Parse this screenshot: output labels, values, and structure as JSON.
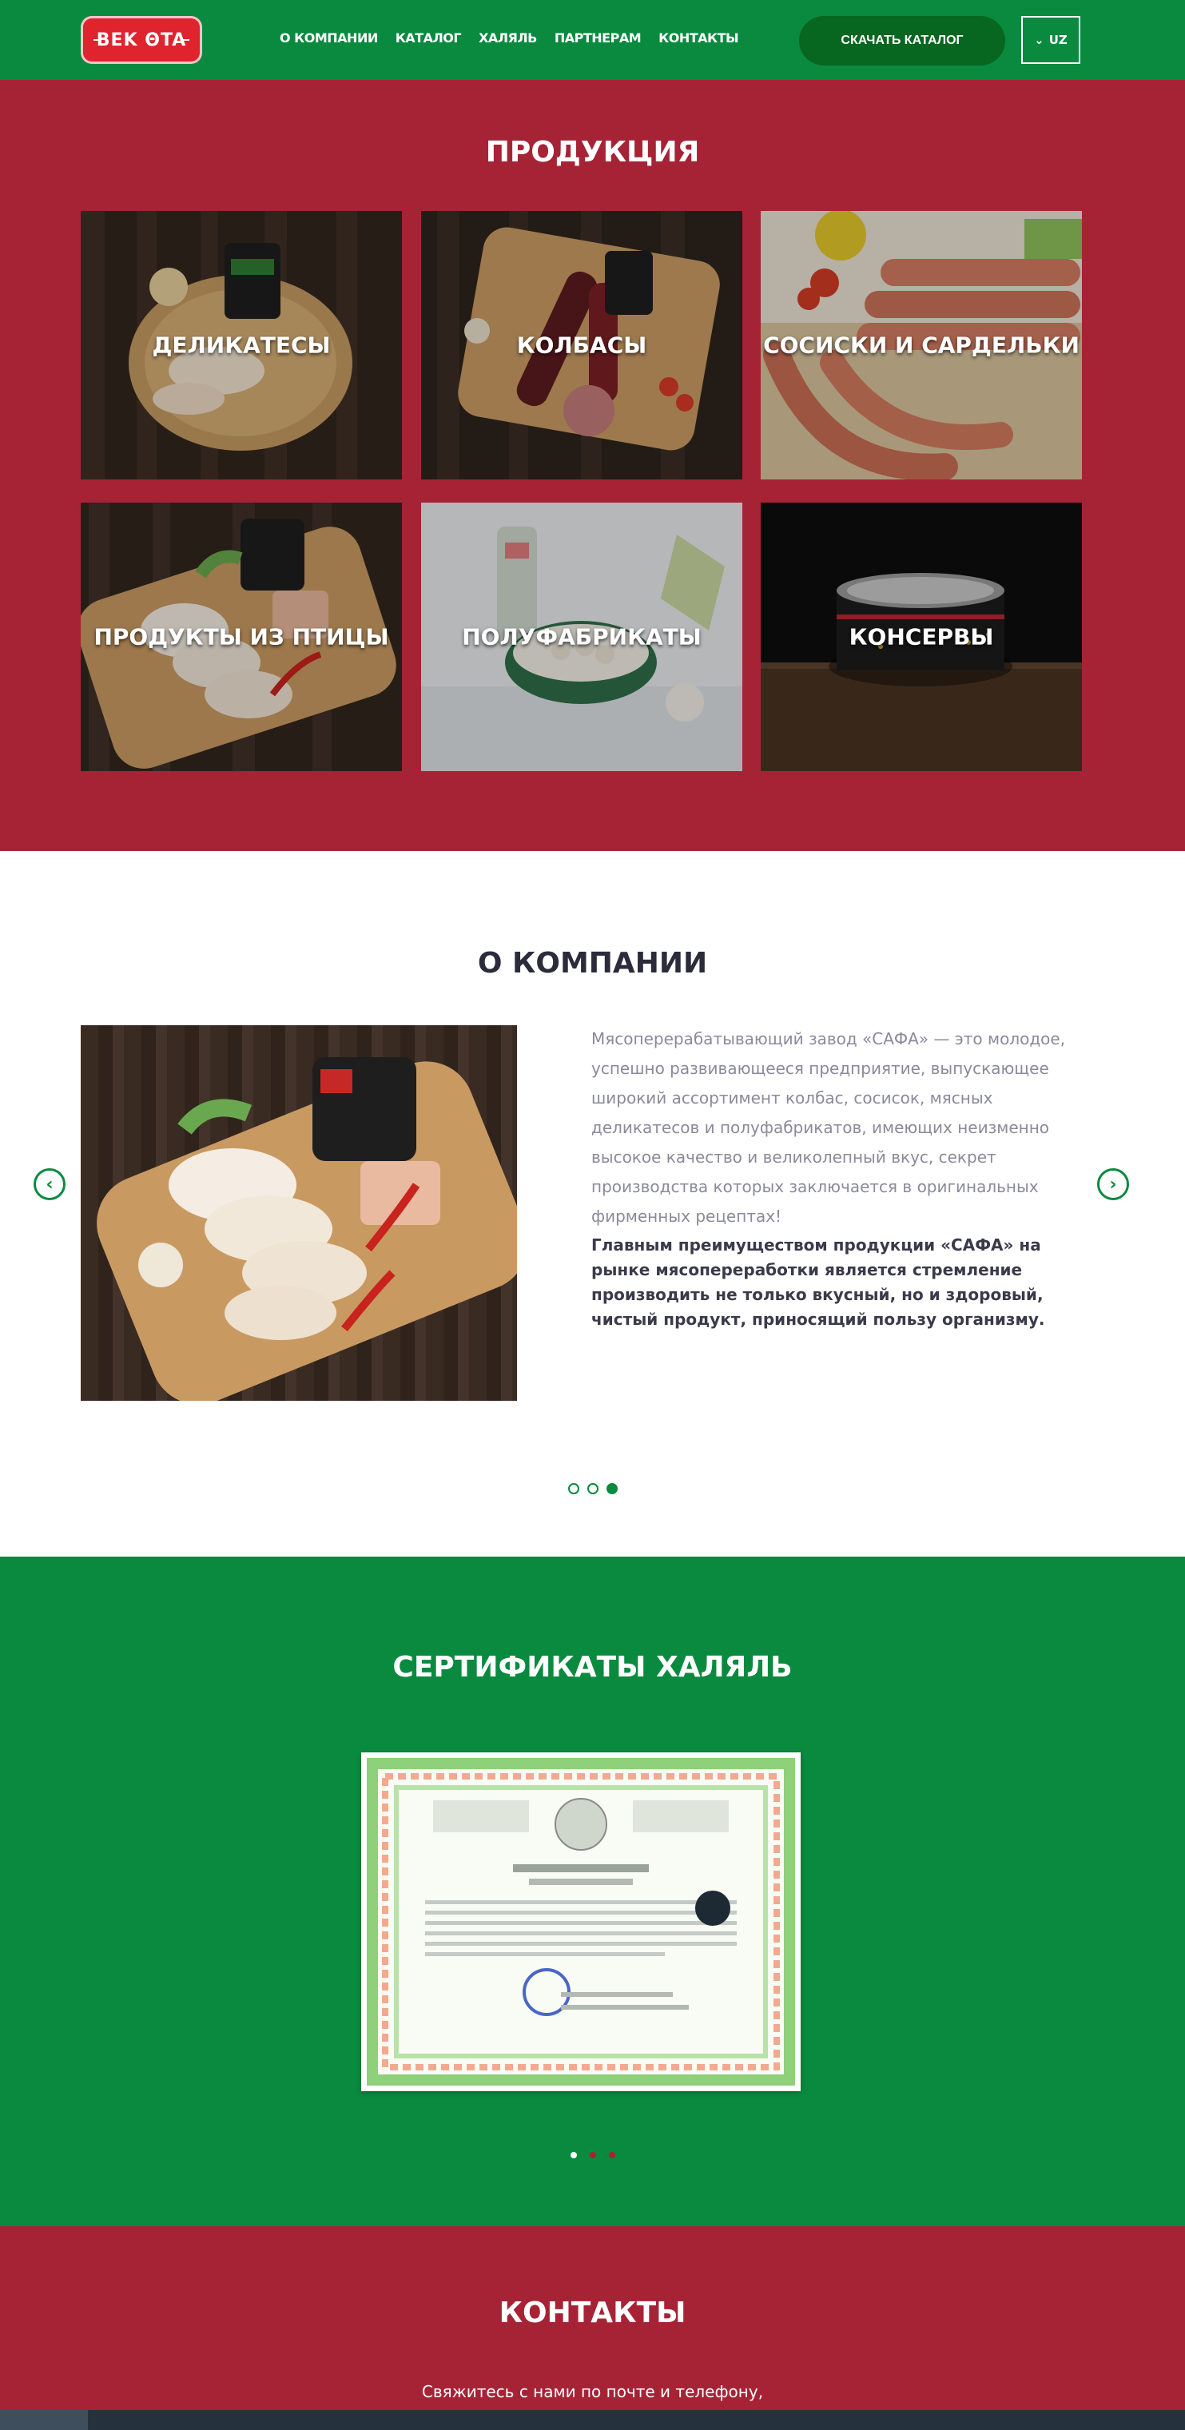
{
  "header": {
    "logo_text": "BEK ΘTA",
    "nav": [
      "О КОМПАНИИ",
      "КАТАЛОГ",
      "ХАЛЯЛЬ",
      "ПАРТНЕРАМ",
      "КОНТАКТЫ"
    ],
    "catalog_button": "СКАЧАТЬ КАТАЛОГ",
    "lang": "UZ",
    "lang_chevron": "⌄"
  },
  "products": {
    "title": "ПРОДУКЦИЯ",
    "items": [
      {
        "label": "ДЕЛИКАТЕСЫ"
      },
      {
        "label": "КОЛБАСЫ"
      },
      {
        "label": "СОСИСКИ И САРДЕЛЬКИ"
      },
      {
        "label": "ПРОДУКТЫ ИЗ ПТИЦЫ"
      },
      {
        "label": "ПОЛУФАБРИКАТЫ"
      },
      {
        "label": "КОНСЕРВЫ"
      }
    ]
  },
  "about": {
    "title": "О КОМПАНИИ",
    "paragraph": "Мясоперерабатывающий завод «САФА» — это молодое, успешно развивающееся предприятие, выпускающее широкий ассортимент колбас, сосисок, мясных деликатесов и полуфабрикатов, имеющих неизменно высокое качество и великолепный вкус, секрет производства которых заключается в оригинальных фирменных рецептах!",
    "bold": "Главным преимуществом продукции «САФА» на рынке мясопереработки является стремление производить не только вкусный, но и здоровый, чистый продукт, приносящий пользу организму.",
    "prev_symbol": "‹",
    "next_symbol": "›",
    "active_slide": 3,
    "slide_count": 3
  },
  "certificates": {
    "title": "СЕРТИФИКАТЫ ХАЛЯЛЬ",
    "active_slide": 1,
    "slide_count": 3
  },
  "contacts": {
    "title": "КОНТАКТЫ",
    "subtitle": "Свяжитесь с нами по почте и телефону,"
  },
  "colors": {
    "green": "#0a8a3f",
    "dark_green": "#07661f",
    "crimson": "#a62336",
    "logo_red": "#e0242e"
  }
}
